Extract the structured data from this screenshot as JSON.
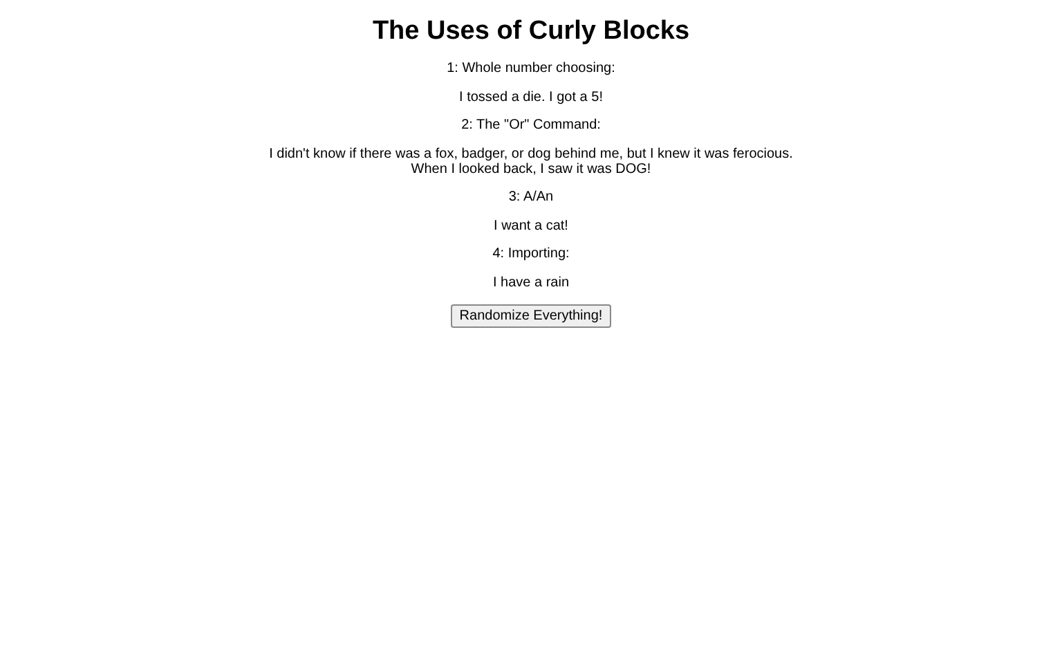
{
  "title": "The Uses of Curly Blocks",
  "sections": [
    {
      "heading": "1: Whole number choosing:",
      "text": "I tossed a die. I got a 5!"
    },
    {
      "heading": "2: The \"Or\" Command:",
      "text": "I didn't know if there was a fox, badger, or dog behind me, but I knew it was ferocious. When I looked back, I saw it was DOG!"
    },
    {
      "heading": "3: A/An",
      "text": "I want a cat!"
    },
    {
      "heading": "4: Importing:",
      "text": "I have a rain"
    }
  ],
  "button": "Randomize Everything!"
}
